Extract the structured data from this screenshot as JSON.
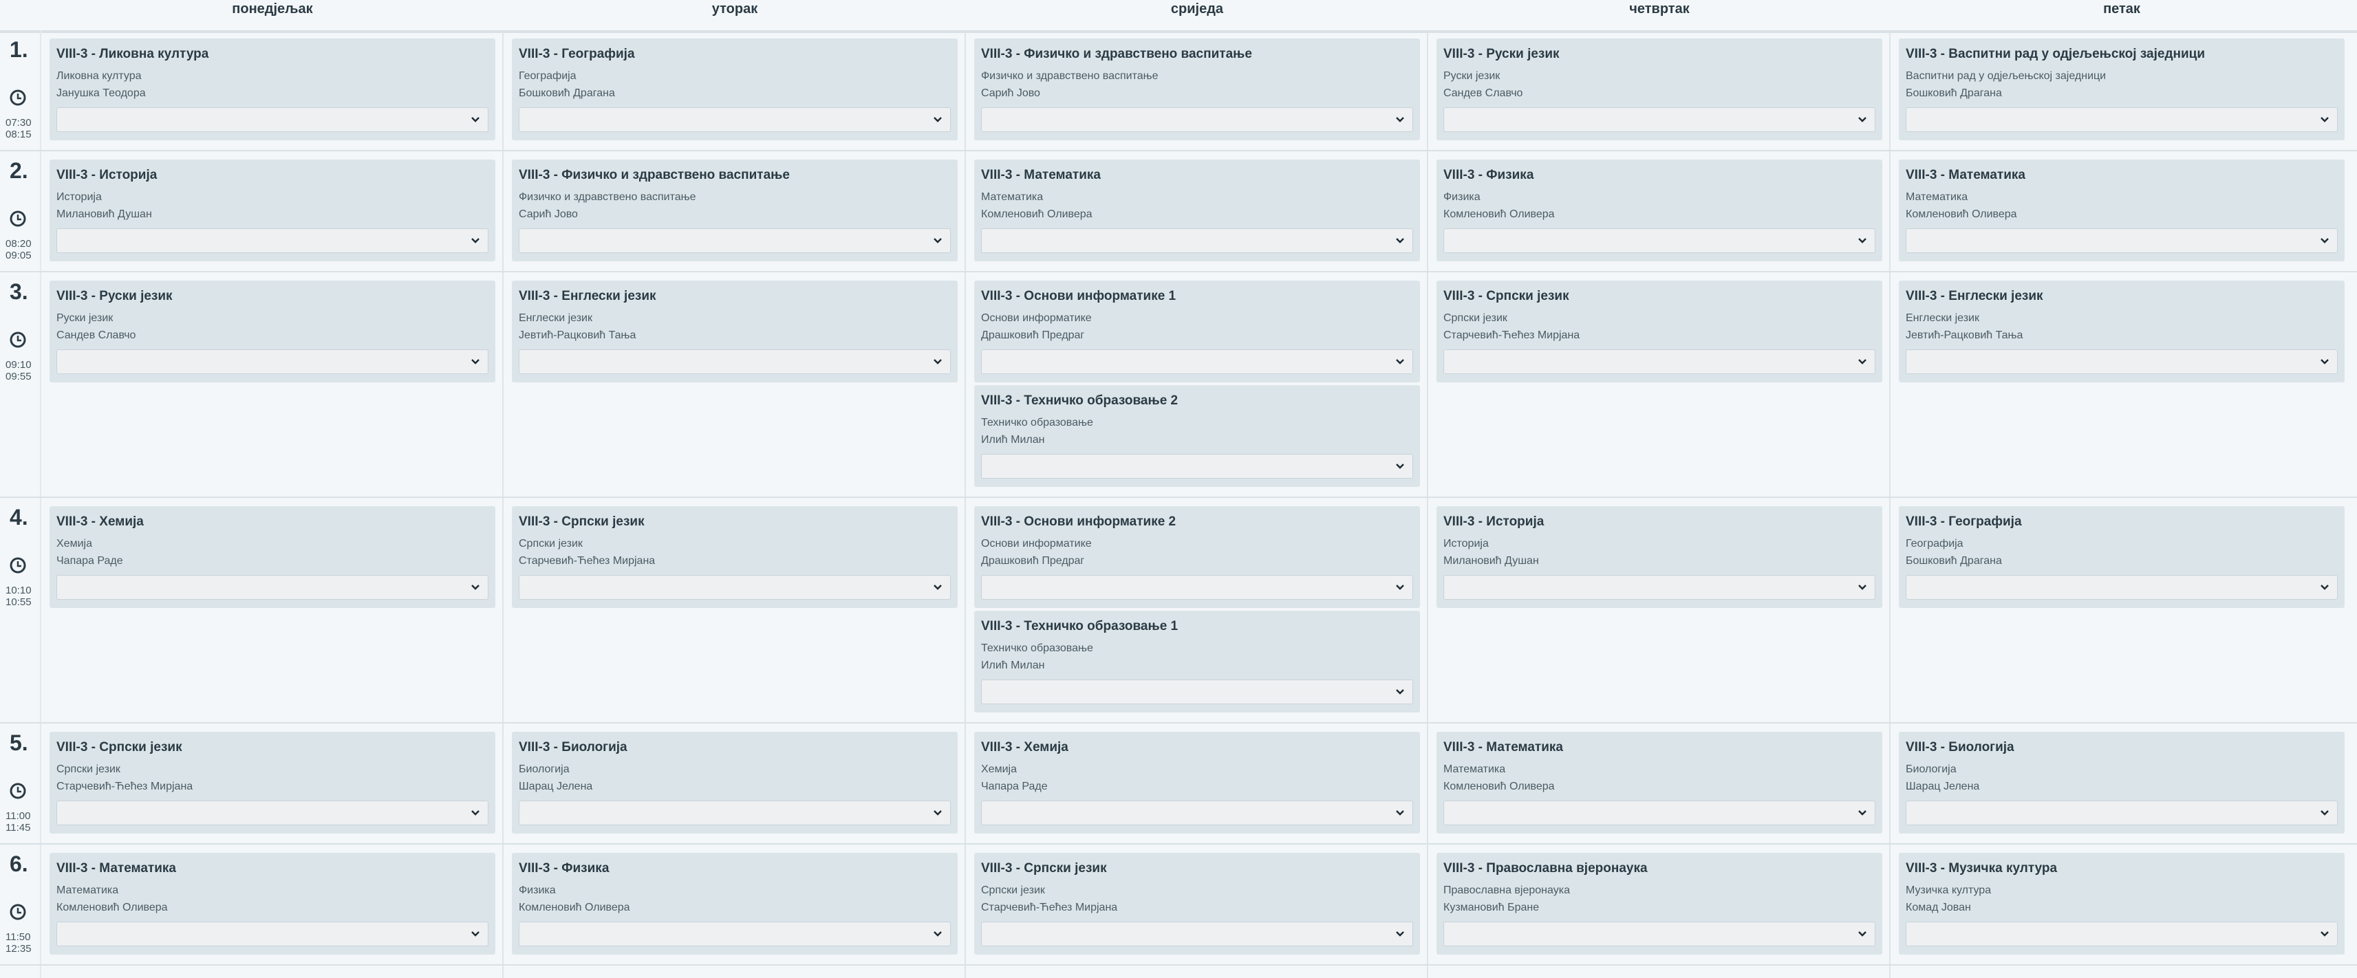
{
  "days": [
    "понедјељак",
    "уторак",
    "сриједа",
    "четвртак",
    "петак"
  ],
  "periods": [
    {
      "num": "1.",
      "start": "07:30",
      "end": "08:15",
      "cells": [
        [
          {
            "title": "VIII-3 - Ликовна култура",
            "subject": "Ликовна култура",
            "teacher": "Јанушка Теодора"
          }
        ],
        [
          {
            "title": "VIII-3 - Географија",
            "subject": "Географија",
            "teacher": "Бошковић Драгана"
          }
        ],
        [
          {
            "title": "VIII-3 - Физичко и здравствено васпитање",
            "subject": "Физичко и здравствено васпитање",
            "teacher": "Сарић Јово"
          }
        ],
        [
          {
            "title": "VIII-3 - Руски језик",
            "subject": "Руски језик",
            "teacher": "Сандев Славчо"
          }
        ],
        [
          {
            "title": "VIII-3 - Васпитни рад у одјељењској заједници",
            "subject": "Васпитни рад у одјељењској заједници",
            "teacher": "Бошковић Драгана"
          }
        ]
      ]
    },
    {
      "num": "2.",
      "start": "08:20",
      "end": "09:05",
      "cells": [
        [
          {
            "title": "VIII-3 - Историја",
            "subject": "Историја",
            "teacher": "Милановић Душан"
          }
        ],
        [
          {
            "title": "VIII-3 - Физичко и здравствено васпитање",
            "subject": "Физичко и здравствено васпитање",
            "teacher": "Сарић Јово"
          }
        ],
        [
          {
            "title": "VIII-3 - Математика",
            "subject": "Математика",
            "teacher": "Комленовић Оливера"
          }
        ],
        [
          {
            "title": "VIII-3 - Физика",
            "subject": "Физика",
            "teacher": "Комленовић Оливера"
          }
        ],
        [
          {
            "title": "VIII-3 - Математика",
            "subject": "Математика",
            "teacher": "Комленовић Оливера"
          }
        ]
      ]
    },
    {
      "num": "3.",
      "start": "09:10",
      "end": "09:55",
      "cells": [
        [
          {
            "title": "VIII-3 - Руски језик",
            "subject": "Руски језик",
            "teacher": "Сандев Славчо"
          }
        ],
        [
          {
            "title": "VIII-3 - Енглески језик",
            "subject": "Енглески језик",
            "teacher": "Јевтић-Рацковић Тања"
          }
        ],
        [
          {
            "title": "VIII-3 - Основи информатике 1",
            "subject": "Основи информатике",
            "teacher": "Драшковић Предраг"
          },
          {
            "title": "VIII-3 - Техничко образовање 2",
            "subject": "Техничко образовање",
            "teacher": "Илић Милан"
          }
        ],
        [
          {
            "title": "VIII-3 - Српски језик",
            "subject": "Српски језик",
            "teacher": "Старчевић-Ћећез Мирјана"
          }
        ],
        [
          {
            "title": "VIII-3 - Енглески језик",
            "subject": "Енглески језик",
            "teacher": "Јевтић-Рацковић Тања"
          }
        ]
      ]
    },
    {
      "num": "4.",
      "start": "10:10",
      "end": "10:55",
      "cells": [
        [
          {
            "title": "VIII-3 - Хемија",
            "subject": "Хемија",
            "teacher": "Чапара Раде"
          }
        ],
        [
          {
            "title": "VIII-3 - Српски језик",
            "subject": "Српски језик",
            "teacher": "Старчевић-Ћећез Мирјана"
          }
        ],
        [
          {
            "title": "VIII-3 - Основи информатике 2",
            "subject": "Основи информатике",
            "teacher": "Драшковић Предраг"
          },
          {
            "title": "VIII-3 - Техничко образовање 1",
            "subject": "Техничко образовање",
            "teacher": "Илић Милан"
          }
        ],
        [
          {
            "title": "VIII-3 - Историја",
            "subject": "Историја",
            "teacher": "Милановић Душан"
          }
        ],
        [
          {
            "title": "VIII-3 - Географија",
            "subject": "Географија",
            "teacher": "Бошковић Драгана"
          }
        ]
      ]
    },
    {
      "num": "5.",
      "start": "11:00",
      "end": "11:45",
      "cells": [
        [
          {
            "title": "VIII-3 - Српски језик",
            "subject": "Српски језик",
            "teacher": "Старчевић-Ћећез Мирјана"
          }
        ],
        [
          {
            "title": "VIII-3 - Биологија",
            "subject": "Биологија",
            "teacher": "Шарац Јелена"
          }
        ],
        [
          {
            "title": "VIII-3 - Хемија",
            "subject": "Хемија",
            "teacher": "Чапара Раде"
          }
        ],
        [
          {
            "title": "VIII-3 - Математика",
            "subject": "Математика",
            "teacher": "Комленовић Оливера"
          }
        ],
        [
          {
            "title": "VIII-3 - Биологија",
            "subject": "Биологија",
            "teacher": "Шарац Јелена"
          }
        ]
      ]
    },
    {
      "num": "6.",
      "start": "11:50",
      "end": "12:35",
      "cells": [
        [
          {
            "title": "VIII-3 - Математика",
            "subject": "Математика",
            "teacher": "Комленовић Оливера"
          }
        ],
        [
          {
            "title": "VIII-3 - Физика",
            "subject": "Физика",
            "teacher": "Комленовић Оливера"
          }
        ],
        [
          {
            "title": "VIII-3 - Српски језик",
            "subject": "Српски језик",
            "teacher": "Старчевић-Ћећез Мирјана"
          }
        ],
        [
          {
            "title": "VIII-3 - Православна вјеронаука",
            "subject": "Православна вјеронаука",
            "teacher": "Кузмановић Бране"
          }
        ],
        [
          {
            "title": "VIII-3 - Музичка култура",
            "subject": "Музичка култура",
            "teacher": "Комад Јован"
          }
        ]
      ]
    }
  ],
  "icons": {
    "clock": "clock-icon",
    "chevron": "chevron-down-icon"
  },
  "colors": {
    "card": "#dbe5e9",
    "background": "#f3f7f9",
    "text": "#2b3a44"
  }
}
